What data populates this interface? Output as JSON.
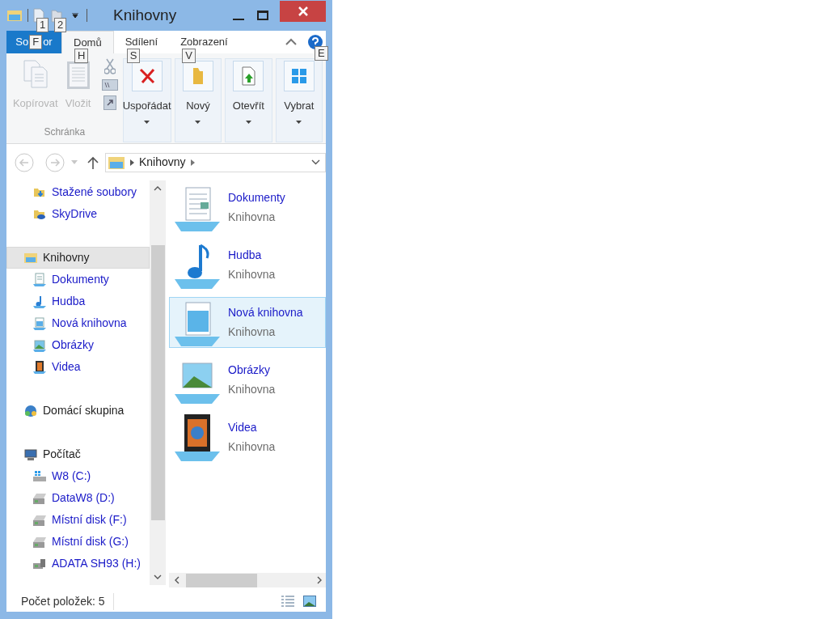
{
  "window": {
    "title": "Knihovny"
  },
  "quick_access": [
    {
      "kind": "properties",
      "keytip": "1"
    },
    {
      "kind": "new-folder",
      "keytip": "2"
    }
  ],
  "file_tab": {
    "label_parts": [
      "So",
      "or"
    ],
    "keytip": "F"
  },
  "tabs": [
    {
      "label": "Domů",
      "selected": true,
      "keytip": "H"
    },
    {
      "label": "Sdílení",
      "selected": false,
      "keytip": "S"
    },
    {
      "label": "Zobrazení",
      "selected": false,
      "keytip": "V"
    }
  ],
  "help_keytip": "E",
  "clipboard": {
    "label": "Schránka",
    "buttons": [
      {
        "label": "Kopírovat",
        "kind": "copy",
        "disabled": true
      },
      {
        "label": "Vložit",
        "kind": "paste",
        "disabled": true
      }
    ]
  },
  "ribbon_buttons": [
    {
      "label": "Uspořádat",
      "kind": "delete"
    },
    {
      "label": "Nový",
      "kind": "folder"
    },
    {
      "label": "Otevřít",
      "kind": "open"
    },
    {
      "label": "Vybrat",
      "kind": "select"
    }
  ],
  "address": {
    "path": "Knihovny"
  },
  "nav": [
    {
      "children": [
        {
          "label": "Stažené soubory",
          "kind": "downloads",
          "selected": false
        },
        {
          "label": "SkyDrive",
          "kind": "cloud",
          "selected": false
        }
      ]
    },
    {
      "label": "Knihovny",
      "kind": "libraries",
      "selected": true,
      "children": [
        {
          "label": "Dokumenty",
          "kind": "documents",
          "selected": false
        },
        {
          "label": "Hudba",
          "kind": "music",
          "selected": false
        },
        {
          "label": "Nová knihovna",
          "kind": "library",
          "selected": false
        },
        {
          "label": "Obrázky",
          "kind": "pictures",
          "selected": false
        },
        {
          "label": "Videa",
          "kind": "videos",
          "selected": false
        }
      ]
    },
    {
      "label": "Domácí skupina",
      "kind": "homegroup",
      "selected": false
    },
    {
      "label": "Počítač",
      "kind": "computer",
      "selected": false,
      "children": [
        {
          "label": "W8 (C:)",
          "kind": "system-drive",
          "selected": false
        },
        {
          "label": "DataW8 (D:)",
          "kind": "drive",
          "selected": false
        },
        {
          "label": "Místní disk (F:)",
          "kind": "drive",
          "selected": false
        },
        {
          "label": "Místní disk (G:)",
          "kind": "drive",
          "selected": false
        },
        {
          "label": "ADATA SH93 (H:)",
          "kind": "usb-drive",
          "selected": false
        }
      ]
    }
  ],
  "items": [
    {
      "name": "Dokumenty",
      "type": "Knihovna",
      "kind": "documents",
      "selected": false
    },
    {
      "name": "Hudba",
      "type": "Knihovna",
      "kind": "music",
      "selected": false
    },
    {
      "name": "Nová knihovna",
      "type": "Knihovna",
      "kind": "library",
      "selected": true
    },
    {
      "name": "Obrázky",
      "type": "Knihovna",
      "kind": "pictures",
      "selected": false
    },
    {
      "name": "Videa",
      "type": "Knihovna",
      "kind": "videos",
      "selected": false
    }
  ],
  "status_bar": {
    "count": "Počet položek: 5"
  }
}
